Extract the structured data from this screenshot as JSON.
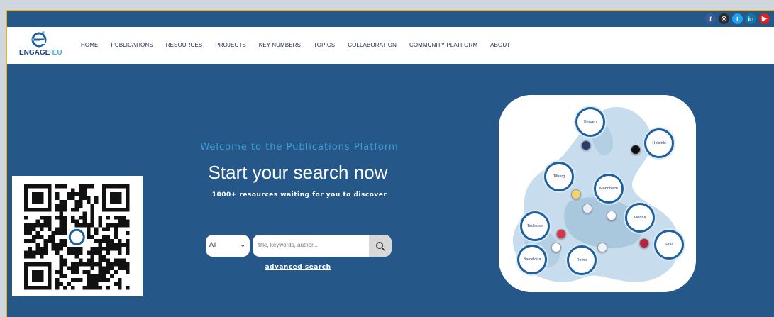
{
  "social": [
    {
      "icon": "facebook-icon",
      "glyph": "f",
      "color": "#3b5998"
    },
    {
      "icon": "instagram-icon",
      "glyph": "◎",
      "color": "#2a2a2a"
    },
    {
      "icon": "twitter-icon",
      "glyph": "t",
      "color": "#1da1f2"
    },
    {
      "icon": "linkedin-icon",
      "glyph": "in",
      "color": "#0e76a8"
    },
    {
      "icon": "youtube-icon",
      "glyph": "▶",
      "color": "#e02020"
    }
  ],
  "logo": {
    "word": "ENGAGE",
    "suffix": "·EU"
  },
  "nav": [
    "HOME",
    "PUBLICATIONS",
    "RESOURCES",
    "PROJECTS",
    "KEY NUMBERS",
    "TOPICS",
    "COLLABORATION",
    "COMMUNITY PLATFORM",
    "ABOUT"
  ],
  "hero": {
    "welcome": "Welcome to the Publications Platform",
    "headline": "Start your search now",
    "tagline": "1000+ resources waiting for you to discover",
    "select_value": "All",
    "search_placeholder": "title, keywords, author...",
    "advanced_link": "advanced search"
  },
  "map": {
    "cities": [
      "Bergen",
      "Helsinki",
      "Tilburg",
      "Mannheim",
      "Vienna",
      "Toulouse",
      "Sofia",
      "Barcelona",
      "Rome"
    ]
  },
  "colors": {
    "brand": "#255789",
    "accent": "#3aa0d6",
    "frame": "#e2b43a"
  }
}
